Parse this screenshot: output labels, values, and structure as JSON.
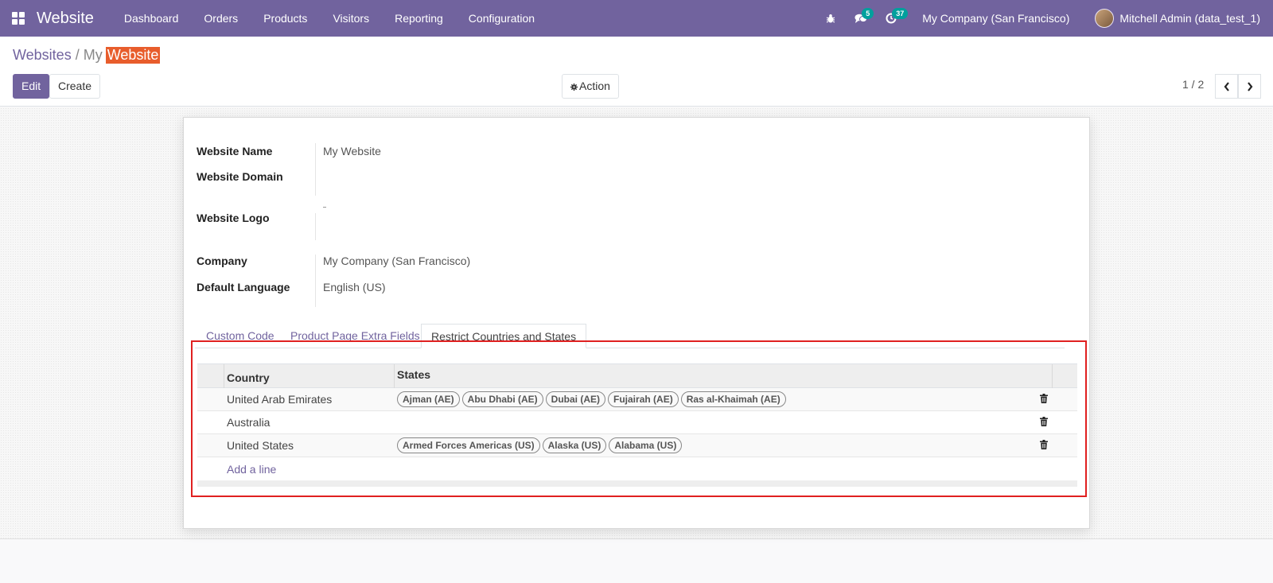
{
  "navbar": {
    "brand": "Website",
    "menu": [
      "Dashboard",
      "Orders",
      "Products",
      "Visitors",
      "Reporting",
      "Configuration"
    ],
    "messages_badge": "5",
    "activities_badge": "37",
    "company": "My Company (San Francisco)",
    "user": "Mitchell Admin (data_test_1)"
  },
  "breadcrumb": {
    "parent": "Websites",
    "separator": "/",
    "current_prefix": "My",
    "current_highlight": "Website"
  },
  "buttons": {
    "edit": "Edit",
    "create": "Create",
    "action": "Action"
  },
  "pager": {
    "value": "1 / 2"
  },
  "form": {
    "website_name_label": "Website Name",
    "website_name_value": "My Website",
    "website_domain_label": "Website Domain",
    "website_domain_value": "",
    "website_logo_label": "Website Logo",
    "company_label": "Company",
    "company_value": "My Company (San Francisco)",
    "default_language_label": "Default Language",
    "default_language_value": "English (US)"
  },
  "tabs": [
    "Custom Code",
    "Product Page Extra Fields",
    "Restrict Countries and States"
  ],
  "active_tab": 2,
  "table": {
    "headers": {
      "country": "Country",
      "states": "States"
    },
    "rows": [
      {
        "country": "United Arab Emirates",
        "states": [
          "Ajman (AE)",
          "Abu Dhabi (AE)",
          "Dubai (AE)",
          "Fujairah (AE)",
          "Ras al-Khaimah (AE)"
        ]
      },
      {
        "country": "Australia",
        "states": []
      },
      {
        "country": "United States",
        "states": [
          "Armed Forces Americas (US)",
          "Alaska (US)",
          "Alabama (US)"
        ]
      }
    ],
    "add_line": "Add a line"
  },
  "colors": {
    "brand": "#71639e",
    "highlight": "#e85d2c",
    "badge": "#00a09d",
    "annotation_box": "#e02020"
  }
}
